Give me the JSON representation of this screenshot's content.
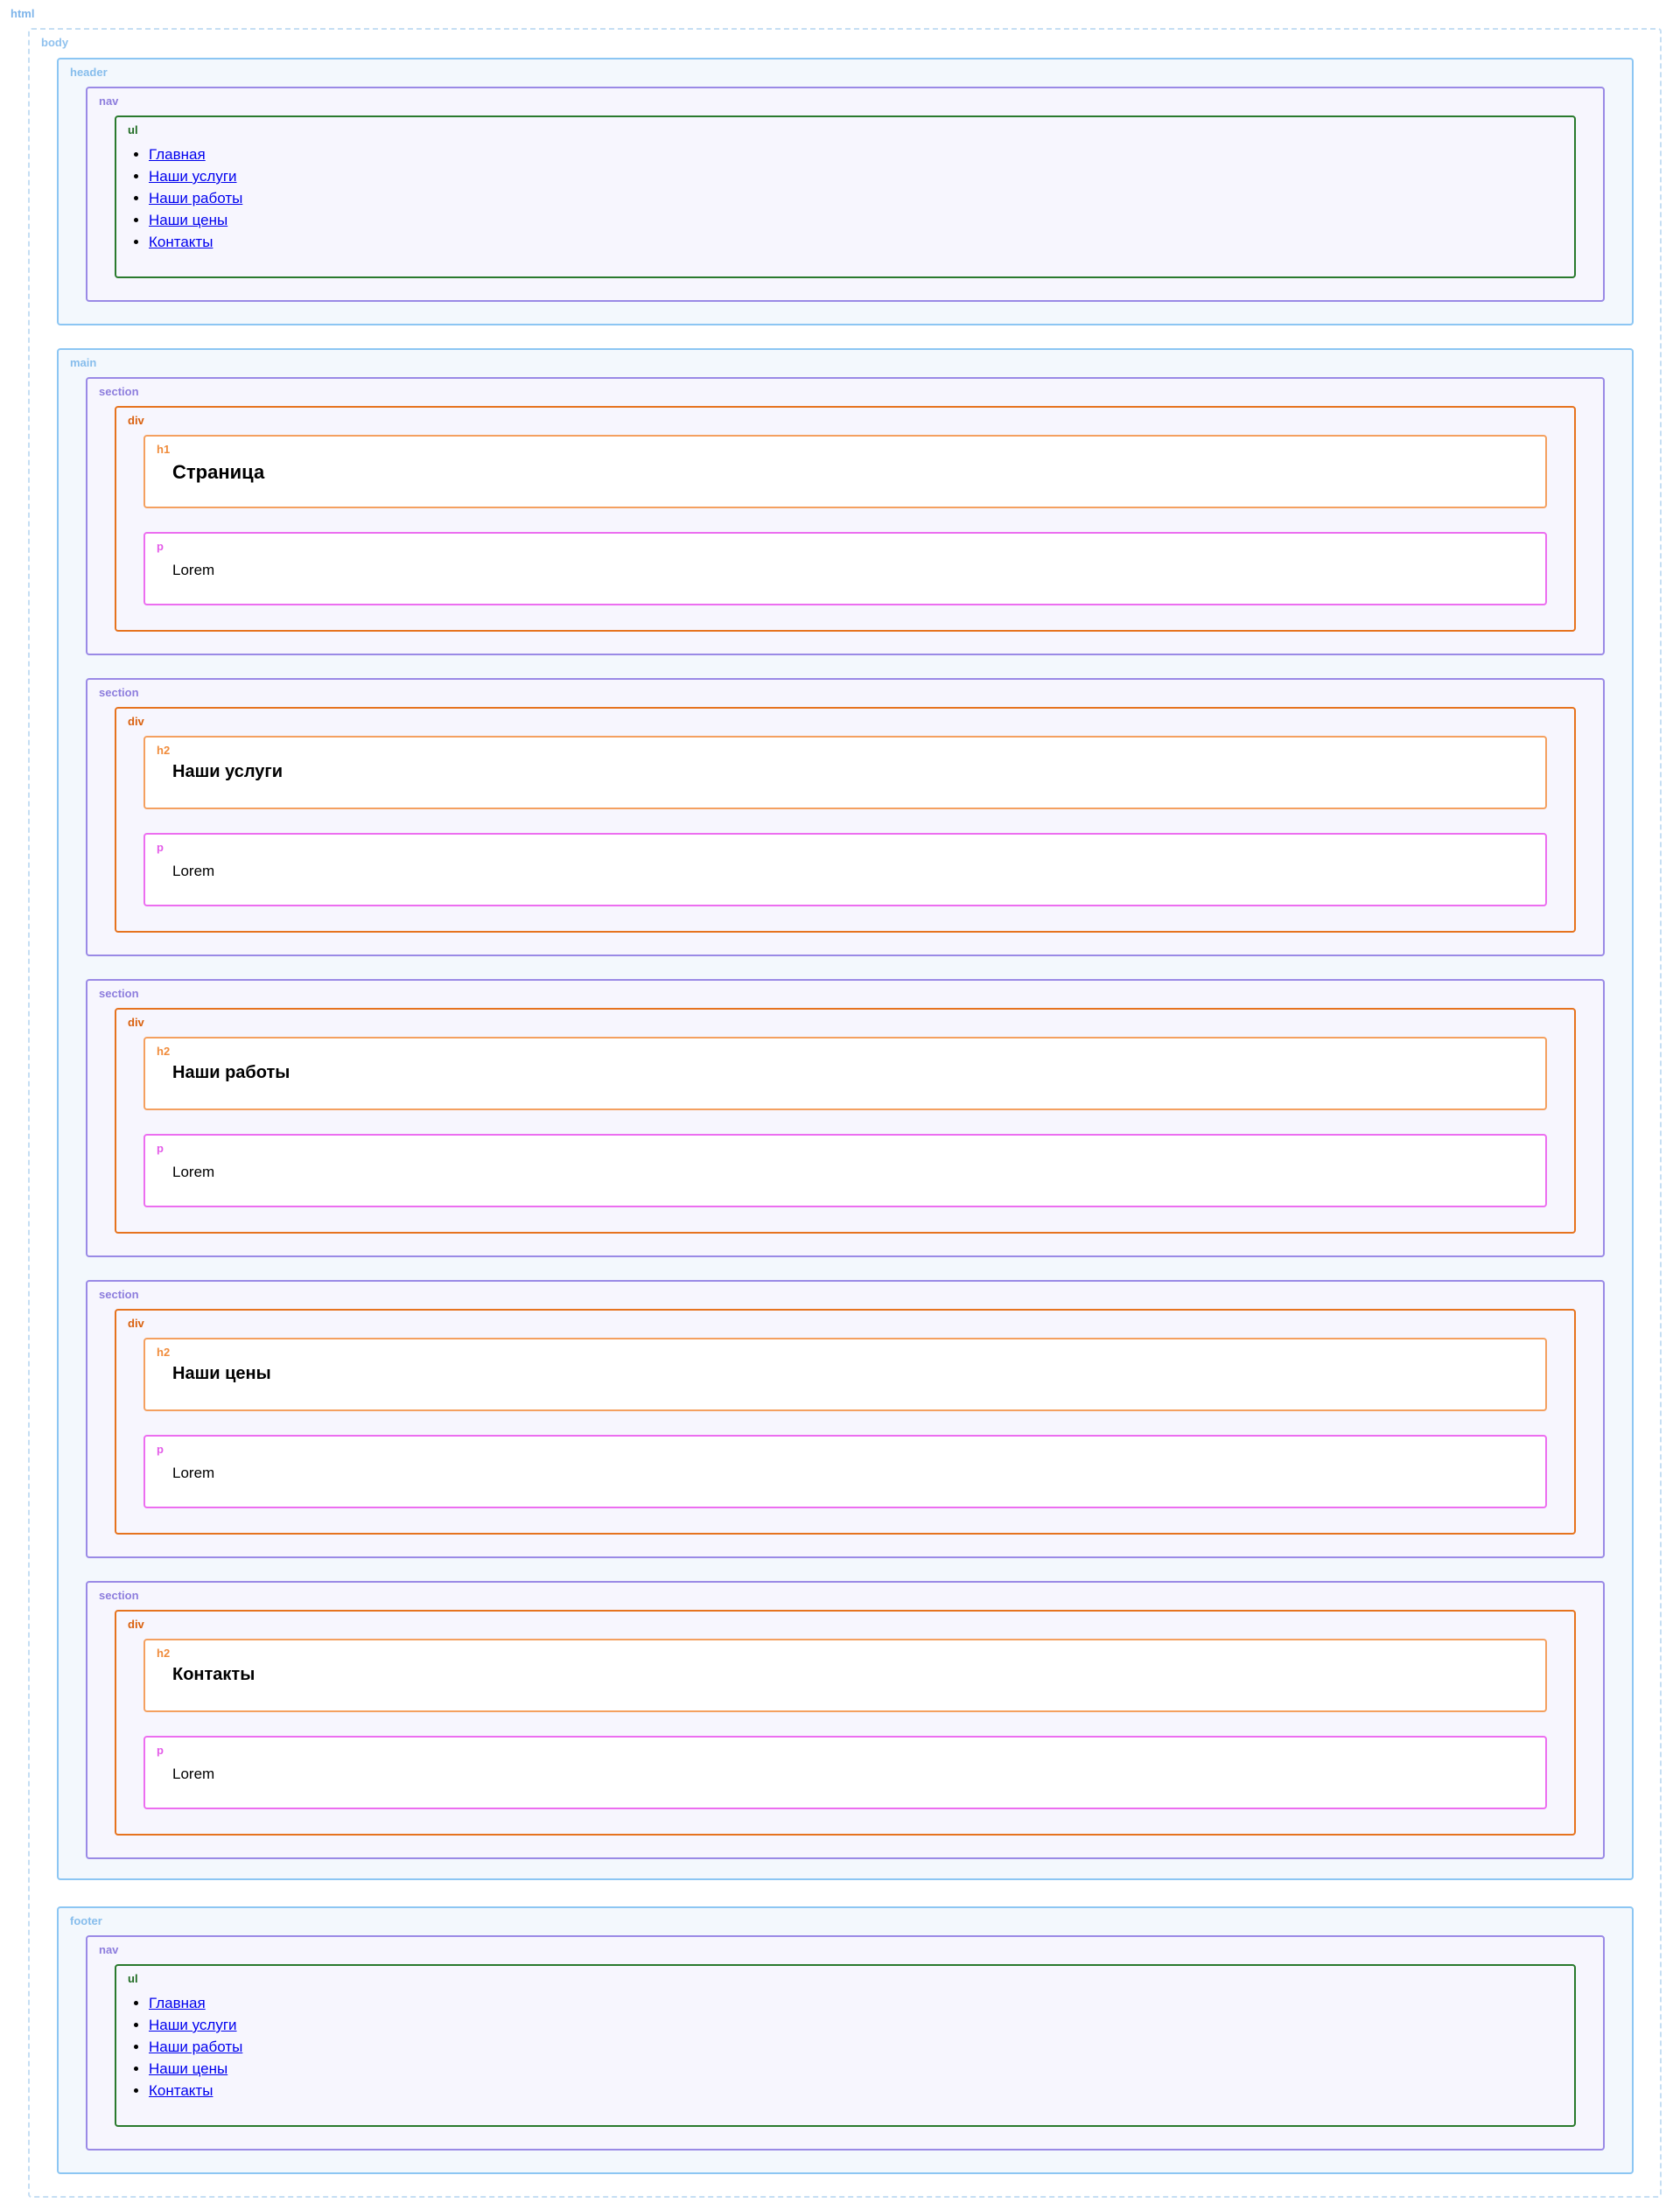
{
  "labels": {
    "html": "html",
    "body": "body",
    "header": "header",
    "nav": "nav",
    "ul": "ul",
    "main": "main",
    "section": "section",
    "div": "div",
    "h1": "h1",
    "h2": "h2",
    "p": "p",
    "footer": "footer"
  },
  "header_nav": [
    "Главная",
    "Наши услуги",
    "Наши работы",
    "Наши цены",
    "Контакты"
  ],
  "sections": [
    {
      "heading_tag": "h1",
      "heading": "Страница",
      "text": "Lorem"
    },
    {
      "heading_tag": "h2",
      "heading": "Наши услуги",
      "text": "Lorem"
    },
    {
      "heading_tag": "h2",
      "heading": "Наши работы",
      "text": "Lorem"
    },
    {
      "heading_tag": "h2",
      "heading": "Наши цены",
      "text": "Lorem"
    },
    {
      "heading_tag": "h2",
      "heading": "Контакты",
      "text": "Lorem"
    }
  ],
  "footer_nav": [
    "Главная",
    "Наши услуги",
    "Наши работы",
    "Наши цены",
    "Контакты"
  ],
  "colors": {
    "html_label": "#7fb5ea",
    "region_border": "#8cc6f3",
    "nav_section_border": "#9a8ae6",
    "ul_border": "#2a7a2e",
    "div_border": "#e6731f",
    "heading_border": "#f4a060",
    "p_border": "#ec6ef0",
    "link": "#0000ee"
  }
}
